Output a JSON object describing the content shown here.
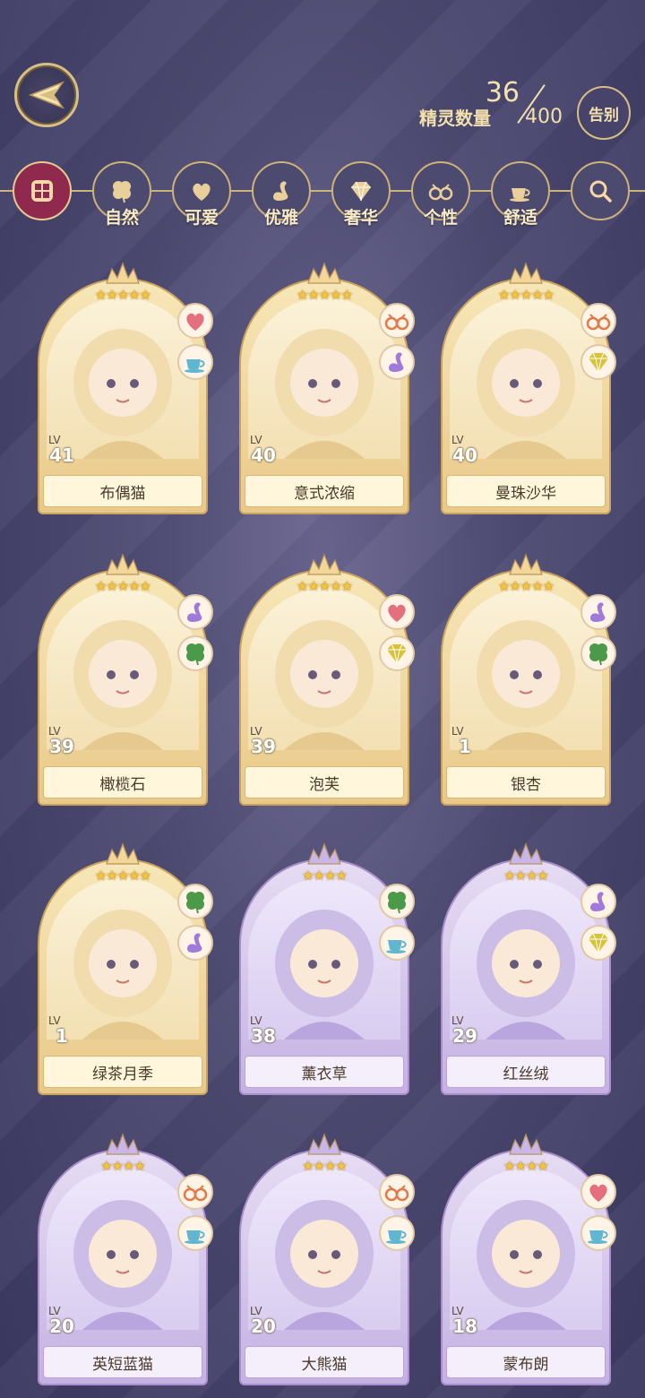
{
  "header": {
    "counter_label": "精灵数量",
    "count_current": "36",
    "count_max": "400",
    "farewell_label": "告别"
  },
  "filters": [
    {
      "label": "",
      "icon": "grid-icon"
    },
    {
      "label": "自然",
      "icon": "clover-icon"
    },
    {
      "label": "可爱",
      "icon": "heart-icon"
    },
    {
      "label": "优雅",
      "icon": "swan-icon"
    },
    {
      "label": "奢华",
      "icon": "diamond-icon"
    },
    {
      "label": "个性",
      "icon": "glasses-icon"
    },
    {
      "label": "舒适",
      "icon": "teacup-icon"
    },
    {
      "label": "",
      "icon": "search-icon"
    }
  ],
  "cards": [
    {
      "name": "布偶猫",
      "lv_text": "LV",
      "level": "41",
      "stars": "★★★★★",
      "tier": "gold",
      "badges": [
        "heart-icon",
        "teacup-icon"
      ]
    },
    {
      "name": "意式浓缩",
      "lv_text": "LV",
      "level": "40",
      "stars": "★★★★★",
      "tier": "gold",
      "badges": [
        "glasses-icon",
        "swan-icon"
      ]
    },
    {
      "name": "曼珠沙华",
      "lv_text": "LV",
      "level": "40",
      "stars": "★★★★★",
      "tier": "gold",
      "badges": [
        "glasses-icon",
        "diamond-icon"
      ]
    },
    {
      "name": "橄榄石",
      "lv_text": "LV",
      "level": "39",
      "stars": "★★★★★",
      "tier": "gold",
      "badges": [
        "swan-icon",
        "clover-icon"
      ]
    },
    {
      "name": "泡芙",
      "lv_text": "LV",
      "level": "39",
      "stars": "★★★★★",
      "tier": "gold",
      "badges": [
        "heart-icon",
        "diamond-icon"
      ]
    },
    {
      "name": "银杏",
      "lv_text": "LV",
      "level": "1",
      "stars": "★★★★★",
      "tier": "gold",
      "badges": [
        "swan-icon",
        "clover-icon"
      ]
    },
    {
      "name": "绿茶月季",
      "lv_text": "LV",
      "level": "1",
      "stars": "★★★★★",
      "tier": "gold",
      "badges": [
        "clover-icon",
        "swan-icon"
      ]
    },
    {
      "name": "薰衣草",
      "lv_text": "LV",
      "level": "38",
      "stars": "★★★★",
      "tier": "purple",
      "badges": [
        "clover-icon",
        "teacup-icon"
      ]
    },
    {
      "name": "红丝绒",
      "lv_text": "LV",
      "level": "29",
      "stars": "★★★★",
      "tier": "purple",
      "badges": [
        "swan-icon",
        "diamond-icon"
      ]
    },
    {
      "name": "英短蓝猫",
      "lv_text": "LV",
      "level": "20",
      "stars": "★★★★",
      "tier": "purple",
      "badges": [
        "glasses-icon",
        "teacup-icon"
      ]
    },
    {
      "name": "大熊猫",
      "lv_text": "LV",
      "level": "20",
      "stars": "★★★★",
      "tier": "purple",
      "badges": [
        "glasses-icon",
        "teacup-icon"
      ]
    },
    {
      "name": "蒙布朗",
      "lv_text": "LV",
      "level": "18",
      "stars": "★★★★",
      "tier": "purple",
      "badges": [
        "heart-icon",
        "teacup-icon"
      ]
    }
  ],
  "colors": {
    "heart": "#e4707f",
    "teacup": "#5fb6d0",
    "glasses": "#e07a4a",
    "swan": "#a07ad8",
    "diamond": "#d8c23a",
    "clover": "#4a9a4a"
  }
}
